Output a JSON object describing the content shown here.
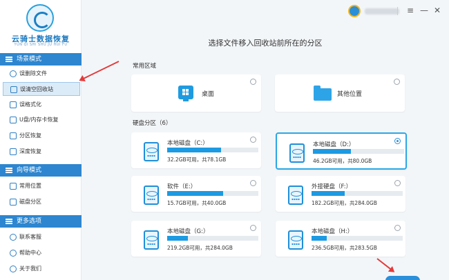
{
  "app": {
    "name": "云骑士数据恢复",
    "name_sub": "YUN QI SHI SHU JU HUI FU"
  },
  "sidebar": {
    "sections": [
      {
        "title": "场景模式",
        "icon": "list-icon"
      },
      {
        "title": "向导模式",
        "icon": "list-icon"
      },
      {
        "title": "更多选项",
        "icon": "list-icon"
      }
    ],
    "scene_items": [
      {
        "label": "误删除文件",
        "icon": "delete-file-icon"
      },
      {
        "label": "误清空回收站",
        "icon": "recycle-bin-icon"
      },
      {
        "label": "误格式化",
        "icon": "format-icon"
      },
      {
        "label": "U盘/内存卡恢复",
        "icon": "usb-icon"
      },
      {
        "label": "分区恢复",
        "icon": "partition-icon"
      },
      {
        "label": "深度恢复",
        "icon": "deep-scan-icon"
      }
    ],
    "guide_items": [
      {
        "label": "常用位置",
        "icon": "location-icon"
      },
      {
        "label": "磁盘分区",
        "icon": "disk-icon"
      }
    ],
    "more_items": [
      {
        "label": "联系客服",
        "icon": "service-icon"
      },
      {
        "label": "帮助中心",
        "icon": "help-icon"
      },
      {
        "label": "关于我们",
        "icon": "info-icon"
      }
    ],
    "active_item": "误清空回收站"
  },
  "titlebar": {
    "avatar_icon": "user-avatar-icon",
    "menu_icon": "≡",
    "minimize_icon": "—",
    "close_icon": "✕"
  },
  "main": {
    "heading": "选择文件移入回收站前所在的分区",
    "common_area_title": "常用区域",
    "common_areas": [
      {
        "label": "桌面",
        "icon": "windows-desktop-icon"
      },
      {
        "label": "其他位置",
        "icon": "folder-icon"
      }
    ],
    "partitions_title": "硬盘分区（6）",
    "partitions": [
      {
        "name": "本地磁盘（C:）",
        "info": "32.2GB可用，共78.1GB",
        "used_fraction": 0.59,
        "selected": false
      },
      {
        "name": "本地磁盘（D:）",
        "info": "46.2GB可用，共80.0GB",
        "used_fraction": 0.42,
        "selected": true
      },
      {
        "name": "软件（E:）",
        "info": "15.7GB可用，共40.0GB",
        "used_fraction": 0.61,
        "selected": false
      },
      {
        "name": "外接硬盘（F:）",
        "info": "182.2GB可用，共284.0GB",
        "used_fraction": 0.36,
        "selected": false
      },
      {
        "name": "本地磁盘（G:）",
        "info": "219.2GB可用，共284.0GB",
        "used_fraction": 0.23,
        "selected": false
      },
      {
        "name": "本地磁盘（H:）",
        "info": "236.5GB可用，共283.5GB",
        "used_fraction": 0.17,
        "selected": false
      }
    ]
  },
  "colors": {
    "accent": "#1c9ae2",
    "section_bar": "#2d86cf",
    "selected_border": "#2ba7e6",
    "annotation_arrow": "#e33b3b"
  }
}
